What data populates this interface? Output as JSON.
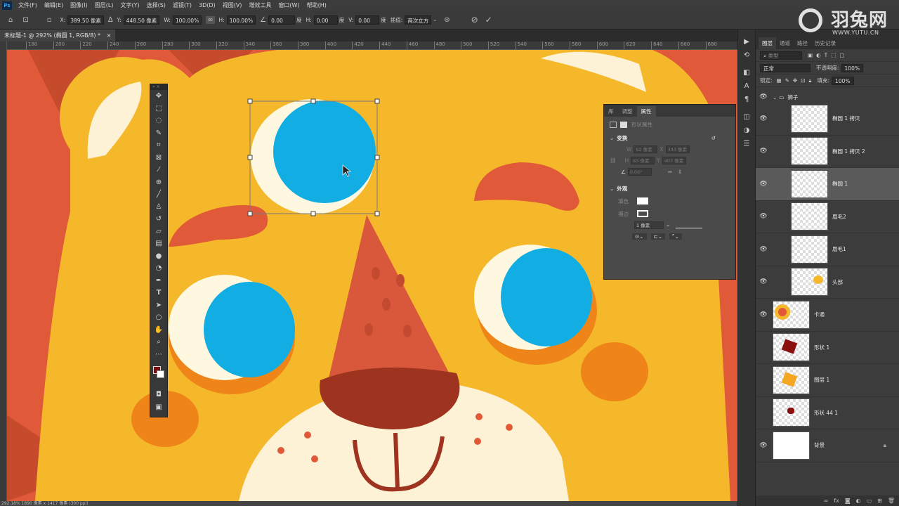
{
  "menubar": {
    "logo": "Ps",
    "items": [
      "文件(F)",
      "编辑(E)",
      "图像(I)",
      "图层(L)",
      "文字(Y)",
      "选择(S)",
      "滤镜(T)",
      "3D(D)",
      "视图(V)",
      "增效工具",
      "窗口(W)",
      "帮助(H)"
    ]
  },
  "options": {
    "x_label": "X:",
    "x_value": "389.50 像素",
    "y_label": "Y:",
    "y_value": "448.50 像素",
    "w_label": "W:",
    "w_value": "100.00%",
    "h_label": "H:",
    "h_value": "100.00%",
    "angle_value": "0.00",
    "angle_unit": "度",
    "hskew_label": "H:",
    "hskew_value": "0.00",
    "hskew_unit": "度",
    "vskew_label": "V:",
    "vskew_value": "0.00",
    "vskew_unit": "度",
    "interp_label": "插值:",
    "interp_value": "两次立方"
  },
  "document": {
    "tab_title": "未标题-1 @ 292% (椭圆 1, RGB/8) *",
    "tab_close": "×"
  },
  "ruler": {
    "ticks": [
      "180",
      "200",
      "220",
      "240",
      "260",
      "280",
      "300",
      "320",
      "340",
      "360",
      "380",
      "400",
      "420",
      "440",
      "460",
      "480",
      "500",
      "520",
      "540",
      "560",
      "580",
      "600",
      "620",
      "640",
      "660",
      "680"
    ]
  },
  "status": {
    "text": "292.18%   1890 像素 x 1417 像素 (300 ppi)"
  },
  "properties": {
    "tabs": [
      "库",
      "调整",
      "属性"
    ],
    "active_tab": "属性",
    "header": "形状属性",
    "transform_title": "变换",
    "w_label": "W",
    "w_value": "92 像素",
    "x_label": "X",
    "x_value": "343 像素",
    "h_label": "H",
    "h_value": "83 像素",
    "y_label": "Y",
    "y_value": "407 像素",
    "angle_value": "0.00°",
    "appearance_title": "外观",
    "fill_label": "填色",
    "stroke_label": "描边",
    "stroke_width": "1 像素"
  },
  "layers": {
    "tabs": [
      "图层",
      "通道",
      "路径",
      "历史记录"
    ],
    "active_tab": "图层",
    "filter_placeholder": "类型",
    "blend_mode": "正常",
    "opacity_label": "不透明度:",
    "opacity_value": "100%",
    "lock_label": "锁定:",
    "fill_label": "填充:",
    "fill_value": "100%",
    "group_name": "狮子",
    "items": [
      {
        "name": "椭圆 1 拷贝"
      },
      {
        "name": "椭圆 1 拷贝 2"
      },
      {
        "name": "椭圆 1"
      },
      {
        "name": "眉毛2"
      },
      {
        "name": "眉毛1"
      },
      {
        "name": "头部"
      },
      {
        "name": "卡通"
      },
      {
        "name": "形状 1"
      },
      {
        "name": "图层 1"
      },
      {
        "name": "形状 44 1"
      },
      {
        "name": "背景"
      }
    ]
  },
  "watermark": {
    "title": "羽兔网",
    "url": "WWW.YUTU.CN"
  },
  "colors": {
    "foreground": "#7a0e0e",
    "background": "#ffffff",
    "lion_yellow": "#f5b82a",
    "mane_orange": "#e05a3a",
    "eye_blue": "#12ade2",
    "cream": "#fff8e0"
  }
}
